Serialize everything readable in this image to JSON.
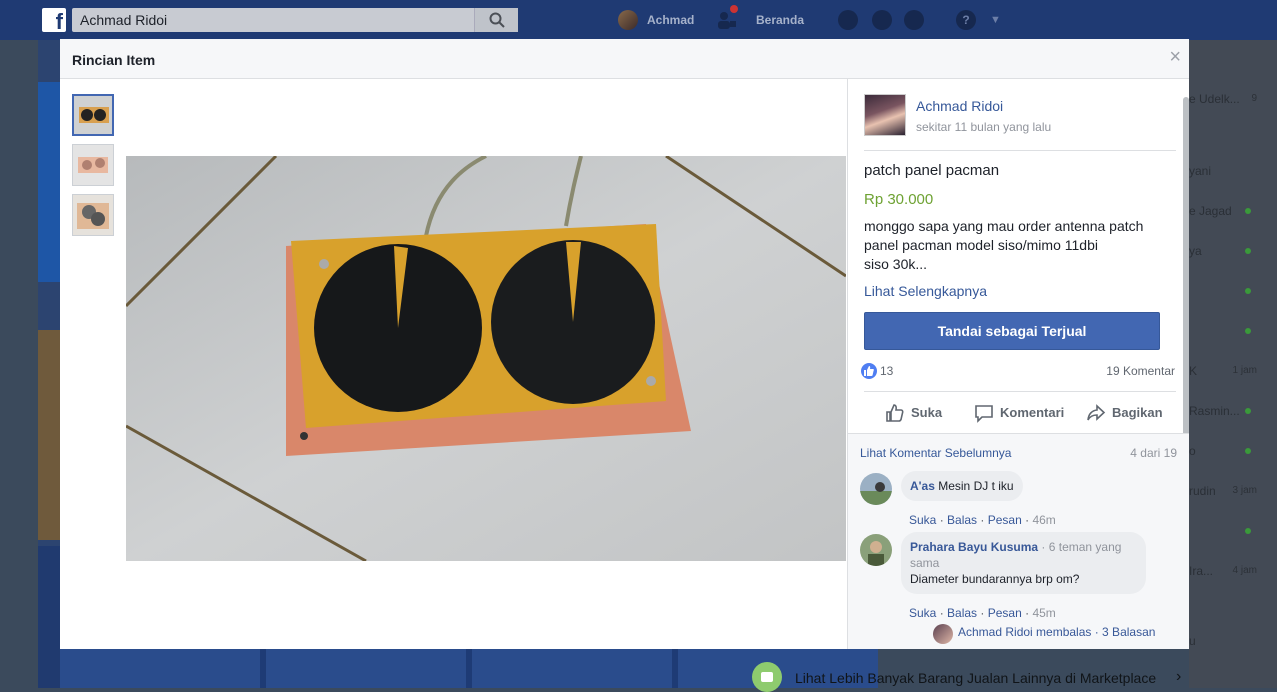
{
  "topbar": {
    "search_value": "Achmad Ridoi",
    "user_name": "Achmad",
    "home_label": "Beranda",
    "brand_color": "#1f3a73"
  },
  "modal": {
    "title": "Rincian Item",
    "close_label": "×"
  },
  "listing": {
    "seller_name": "Achmad Ridoi",
    "posted_time": "sekitar 11 bulan yang lalu",
    "title": "patch panel pacman",
    "price": "Rp 30.000",
    "description_lines": [
      "monggo sapa yang mau order antenna patch",
      "panel pacman model siso/mimo 11dbi",
      "siso 30k..."
    ],
    "see_more": "Lihat Selengkapnya",
    "mark_sold_button": "Tandai sebagai Terjual",
    "like_count": "13",
    "comment_count": "19 Komentar",
    "actions": {
      "like": "Suka",
      "comment": "Komentari",
      "share": "Bagikan"
    },
    "price_color": "#6ea233"
  },
  "comments": {
    "prev_link": "Lihat Komentar Sebelumnya",
    "prev_count": "4 dari 19",
    "items": [
      {
        "author": "A'as",
        "text": "Mesin DJ t iku",
        "meta": "",
        "like": "Suka",
        "reply": "Balas",
        "message": "Pesan",
        "time": "46m"
      },
      {
        "author": "Prahara Bayu Kusuma",
        "text": "Diameter bundarannya brp om?",
        "meta": "· 6 teman yang sama",
        "like": "Suka",
        "reply": "Balas",
        "message": "Pesan",
        "time": "45m"
      }
    ],
    "reply_summary": "Achmad Ridoi membalas · 3 Balasan"
  },
  "sidebar_right": {
    "rows": [
      {
        "text": "e Udelk...",
        "time": "9"
      },
      {
        "text": "yani",
        "time": ""
      },
      {
        "text": "e Jagad",
        "time": ""
      },
      {
        "text": "ya",
        "time": ""
      },
      {
        "text": "",
        "time": ""
      },
      {
        "text": "",
        "time": ""
      },
      {
        "text": "K",
        "time": "1 jam"
      },
      {
        "text": "Rasmin...",
        "time": ""
      },
      {
        "text": "o",
        "time": ""
      },
      {
        "text": "rudin",
        "time": "3 jam"
      },
      {
        "text": "",
        "time": ""
      },
      {
        "text": "Ira...",
        "time": "4 jam"
      },
      {
        "text": "u",
        "time": ""
      }
    ]
  },
  "marketplace_bar": {
    "text": "Lihat Lebih Banyak Barang Jualan Lainnya di Marketplace"
  }
}
